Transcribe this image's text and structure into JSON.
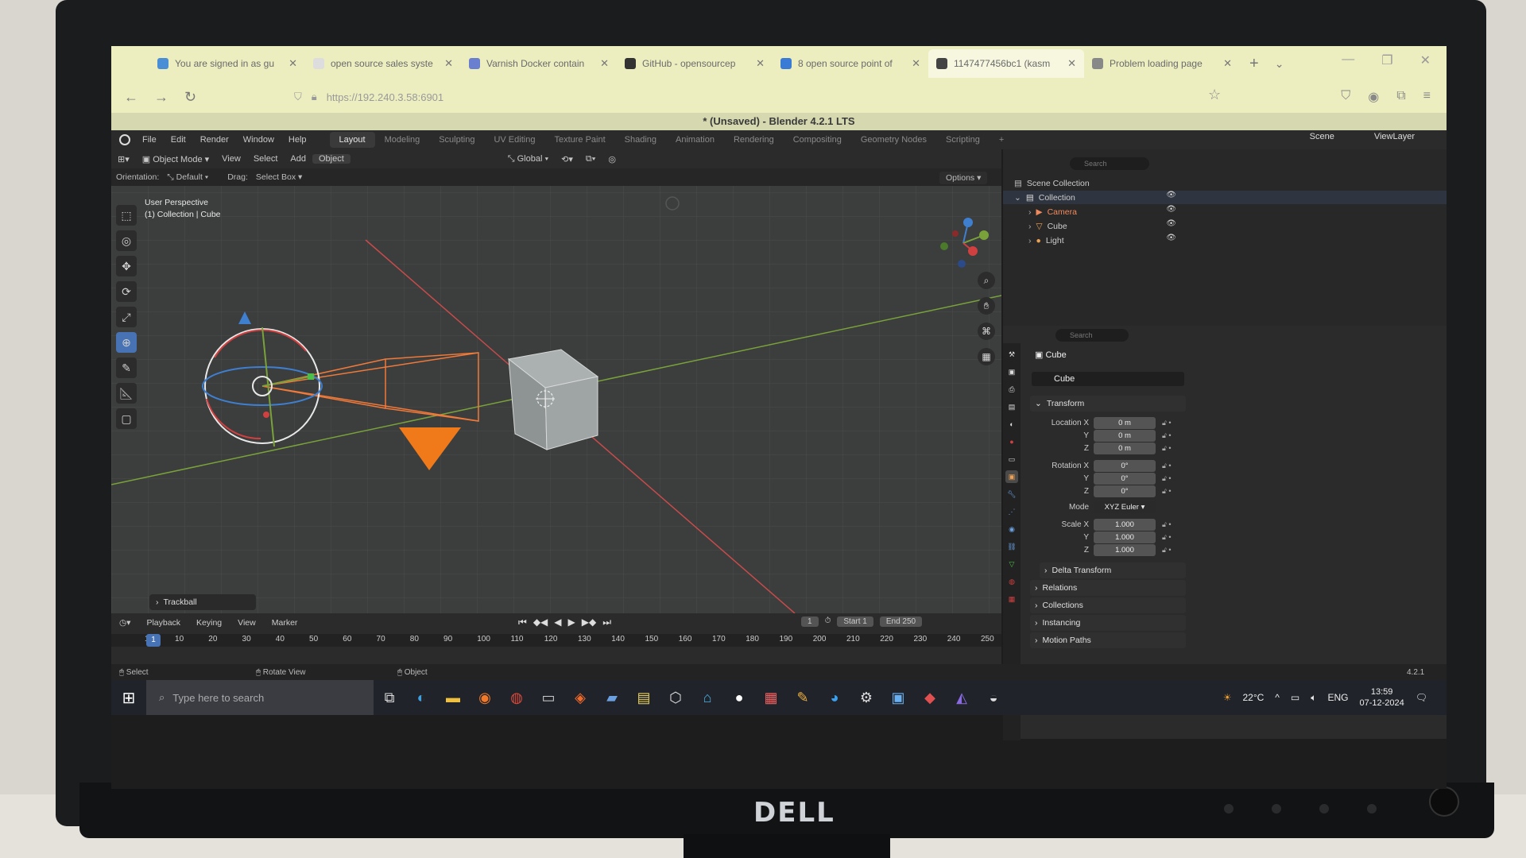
{
  "browser": {
    "tabs": [
      {
        "label": "You are signed in as gu",
        "icon_color": "#4a8fd6",
        "active": false
      },
      {
        "label": "open source sales syste",
        "icon_color": "#dddddd",
        "active": false
      },
      {
        "label": "Varnish Docker contain",
        "icon_color": "#6a7fd0",
        "active": false
      },
      {
        "label": "GitHub - opensourcep",
        "icon_color": "#333333",
        "active": false
      },
      {
        "label": "8 open source point of",
        "icon_color": "#3a7bd5",
        "active": false
      },
      {
        "label": "1147477456bc1 (kasm",
        "icon_color": "#444444",
        "active": true
      },
      {
        "label": "Problem loading page",
        "icon_color": "#888888",
        "active": false
      }
    ],
    "new_tab": "+",
    "url": "https://192.240.3.58:6901"
  },
  "blender": {
    "title": "* (Unsaved) - Blender 4.2.1 LTS",
    "menu": [
      "File",
      "Edit",
      "Render",
      "Window",
      "Help"
    ],
    "workspaces": [
      "Layout",
      "Modeling",
      "Sculpting",
      "UV Editing",
      "Texture Paint",
      "Shading",
      "Animation",
      "Rendering",
      "Compositing",
      "Geometry Nodes",
      "Scripting"
    ],
    "active_workspace": "Layout",
    "scene": "Scene",
    "view_layer": "ViewLayer",
    "header": {
      "mode": "Object Mode",
      "items": [
        "View",
        "Select",
        "Add",
        "Object"
      ],
      "transform": "Global"
    },
    "header2": {
      "orientation_label": "Orientation:",
      "orientation_value": "Default",
      "drag_label": "Drag:",
      "drag_value": "Select Box"
    },
    "options": "Options",
    "viewport": {
      "line1": "User Perspective",
      "line2": "(1) Collection | Cube"
    },
    "operator_panel": "Trackball",
    "outliner": {
      "search_placeholder": "Search",
      "scene_collection": "Scene Collection",
      "collection": "Collection",
      "items": [
        {
          "name": "Camera",
          "color": "#f08a5d"
        },
        {
          "name": "Cube",
          "color": "#e0e0e0"
        },
        {
          "name": "Light",
          "color": "#e0e0e0"
        }
      ]
    },
    "properties": {
      "search_placeholder": "Search",
      "object_title": "Cube",
      "object_name": "Cube",
      "transform_label": "Transform",
      "location_label": "Location X",
      "location": [
        "0 m",
        "0 m",
        "0 m"
      ],
      "rotation_label": "Rotation X",
      "rotation": [
        "0°",
        "0°",
        "0°"
      ],
      "mode_label": "Mode",
      "mode_value": "XYZ Euler",
      "scale_label": "Scale X",
      "scale": [
        "1.000",
        "1.000",
        "1.000"
      ],
      "axis_y": "Y",
      "axis_z": "Z",
      "sections": [
        "Delta Transform",
        "Relations",
        "Collections",
        "Instancing",
        "Motion Paths"
      ]
    },
    "timeline": {
      "menu": [
        "Playback",
        "Keying",
        "View",
        "Marker"
      ],
      "current_frame": "1",
      "start_label": "Start",
      "start": "1",
      "end_label": "End",
      "end": "250",
      "ruler": [
        "1",
        "10",
        "20",
        "30",
        "40",
        "50",
        "60",
        "70",
        "80",
        "90",
        "100",
        "110",
        "120",
        "130",
        "140",
        "150",
        "160",
        "170",
        "180",
        "190",
        "200",
        "210",
        "220",
        "230",
        "240",
        "250"
      ]
    },
    "status": {
      "select": "Select",
      "rotate": "Rotate View",
      "object": "Object",
      "version": "4.2.1"
    }
  },
  "taskbar": {
    "search_placeholder": "Type here to search",
    "weather": "22°C",
    "lang": "ENG",
    "time": "13:59",
    "date": "07-12-2024"
  },
  "monitor": {
    "brand": "DELL"
  }
}
